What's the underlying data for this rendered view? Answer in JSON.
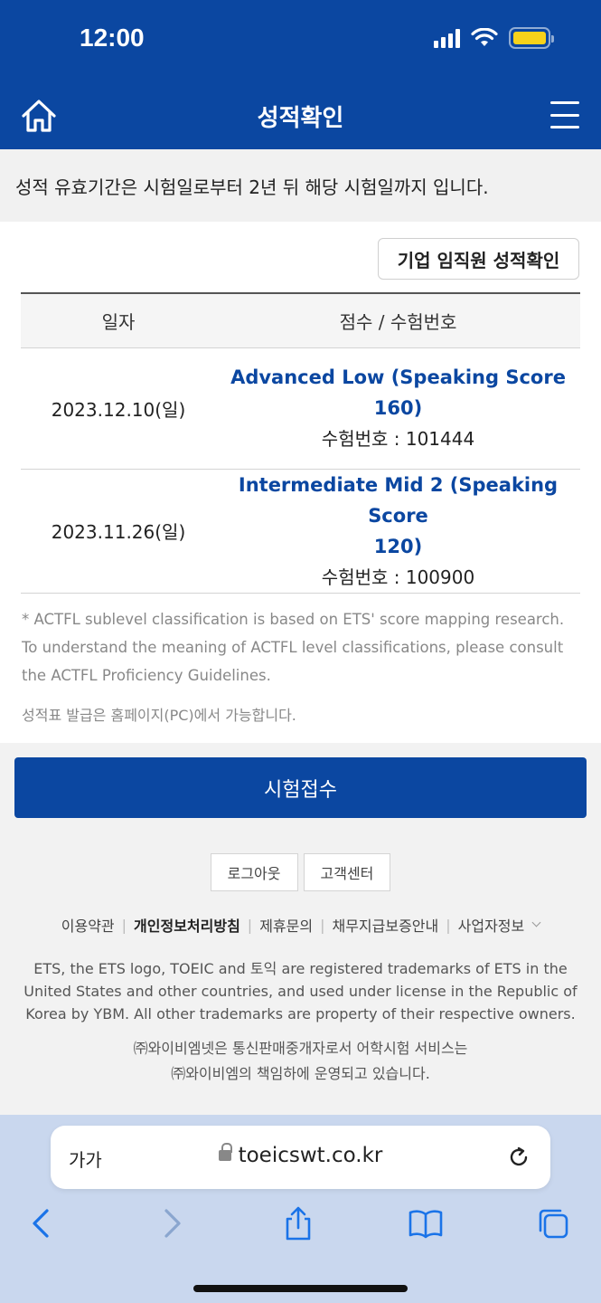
{
  "status_bar": {
    "time": "12:00"
  },
  "header": {
    "title": "성적확인"
  },
  "notice": "성적 유효기간은 시험일로부터 2년 뒤 해당 시험일까지 입니다.",
  "corp_button": "기업 임직원 성적확인",
  "table": {
    "headers": [
      "일자",
      "점수 / 수험번호"
    ],
    "rows": [
      {
        "date": "2023.12.10(일)",
        "level_line1": "Advanced Low (Speaking Score",
        "level_line2": "160)",
        "exam_no": "수험번호 : 101444"
      },
      {
        "date": "2023.11.26(일)",
        "level_line1": "Intermediate Mid 2 (Speaking Score",
        "level_line2": "120)",
        "exam_no": "수험번호 : 100900"
      }
    ]
  },
  "footnote": {
    "line1": "* ACTFL sublevel classification is based on ETS' score mapping research.",
    "line2": "To understand the meaning of ACTFL level classifications, please consult",
    "line3": "the ACTFL Proficiency Guidelines."
  },
  "print_note": "성적표 발급은 홈페이지(PC)에서 가능합니다.",
  "apply_button": "시험접수",
  "footer": {
    "buttons": [
      "로그아웃",
      "고객센터"
    ],
    "links": [
      "이용약관",
      "개인정보처리방침",
      "제휴문의",
      "채무지급보증안내",
      "사업자정보"
    ],
    "trademark": {
      "line1": "ETS, the ETS logo, TOEIC and 토익 are registered trademarks of ETS in the",
      "line2": "United States and other countries, and used under license in the Republic of",
      "line3": "Korea by YBM. All other trademarks are property of their respective owners."
    },
    "ybm": {
      "line1": "㈜와이비엠넷은 통신판매중개자로서 어학시험 서비스는",
      "line2": "㈜와이비엠의 책임하에 운영되고 있습니다."
    }
  },
  "browser": {
    "aa_label": "가가",
    "url": "toeicswt.co.kr"
  },
  "colors": {
    "brand": "#0b47a1",
    "battery": "#f7d21a",
    "browser_bar": "#c9d7ee"
  }
}
